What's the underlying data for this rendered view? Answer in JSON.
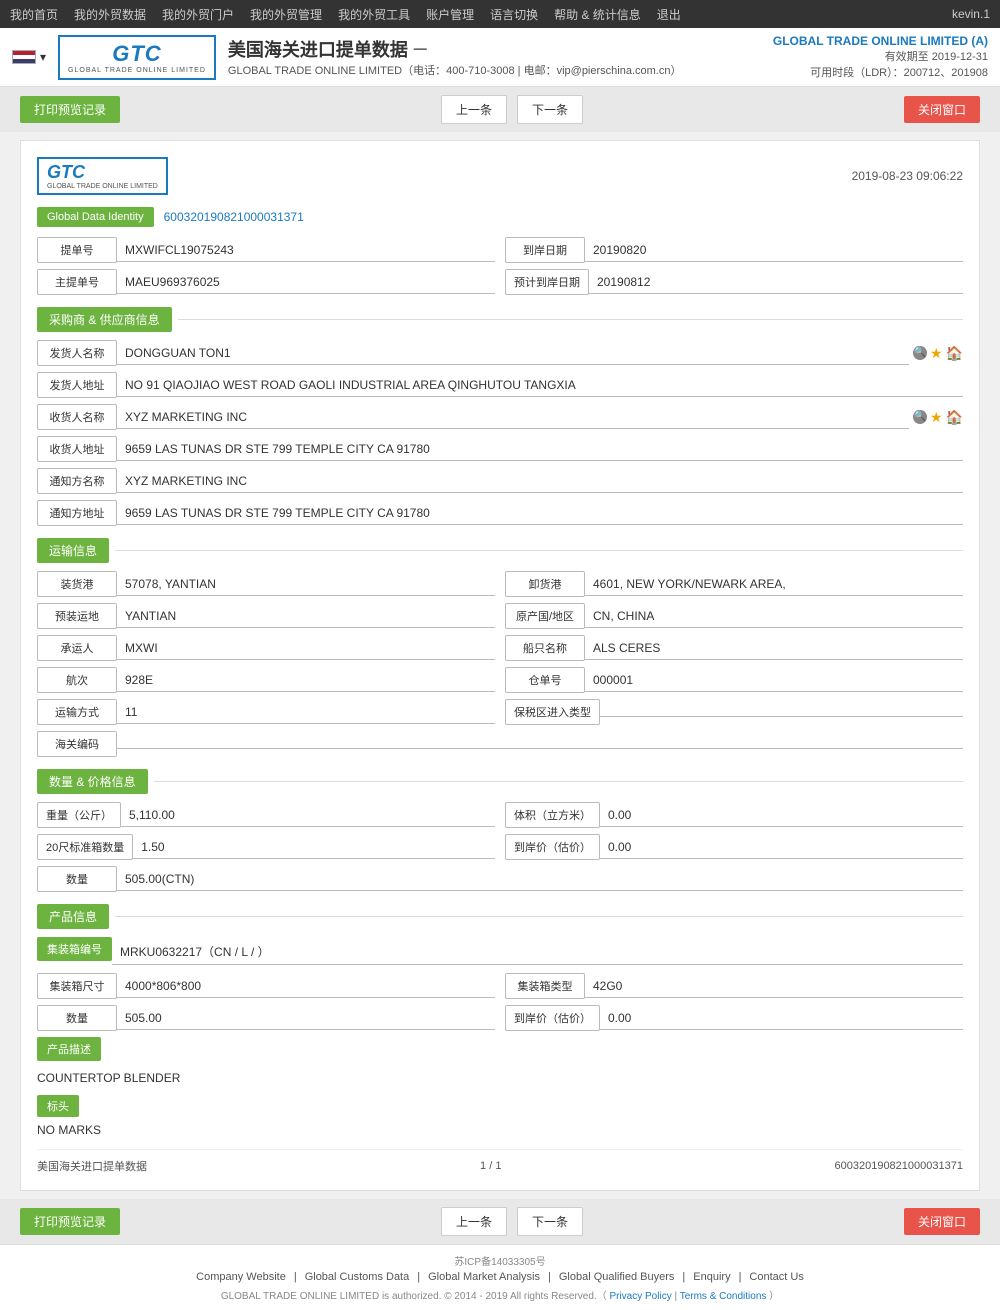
{
  "nav": {
    "items": [
      "我的首页",
      "我的外贸数据",
      "我的外贸门户",
      "我的外贸管理",
      "我的外贸工具",
      "账户管理",
      "语言切换",
      "帮助 & 统计信息",
      "退出"
    ],
    "user": "kevin.1"
  },
  "header": {
    "logo_text": "GTC",
    "logo_sub": "GLOBAL TRADE ONLINE LIMITED",
    "title": "美国海关进口提单数据",
    "dash": "－",
    "contact": "GLOBAL TRADE ONLINE LIMITED（电话：400-710-3008 | 电邮：vip@pierschina.com.cn）",
    "company": "GLOBAL TRADE ONLINE LIMITED (A)",
    "validity": "有效期至 2019-12-31",
    "ldr": "可用时段（LDR）：200712、201908"
  },
  "toolbar": {
    "print_label": "打印预览记录",
    "prev_label": "上一条",
    "next_label": "下一条",
    "close_label": "关闭窗口"
  },
  "card": {
    "date": "2019-08-23 09:06:22",
    "global_data_identity_label": "Global Data Identity",
    "global_data_identity_value": "600320190821000031371",
    "bill_no_label": "提单号",
    "bill_no_value": "MXWIFCL19075243",
    "arrival_date_label": "到岸日期",
    "arrival_date_value": "20190820",
    "master_bill_label": "主提单号",
    "master_bill_value": "MAEU969376025",
    "estimated_arrival_label": "预计到岸日期",
    "estimated_arrival_value": "20190812"
  },
  "supplier": {
    "section_title": "采购商 & 供应商信息",
    "shipper_name_label": "发货人名称",
    "shipper_name_value": "DONGGUAN TON1",
    "shipper_addr_label": "发货人地址",
    "shipper_addr_value": "NO 91 QIAOJIAO WEST ROAD GAOLI INDUSTRIAL AREA QINGHUTOU TANGXIA",
    "consignee_name_label": "收货人名称",
    "consignee_name_value": "XYZ MARKETING INC",
    "consignee_addr_label": "收货人地址",
    "consignee_addr_value": "9659 LAS TUNAS DR STE 799 TEMPLE CITY CA 91780",
    "notify_name_label": "通知方名称",
    "notify_name_value": "XYZ MARKETING INC",
    "notify_addr_label": "通知方地址",
    "notify_addr_value": "9659 LAS TUNAS DR STE 799 TEMPLE CITY CA 91780"
  },
  "transport": {
    "section_title": "运输信息",
    "loading_port_label": "装货港",
    "loading_port_value": "57078, YANTIAN",
    "discharge_port_label": "卸货港",
    "discharge_port_value": "4601, NEW YORK/NEWARK AREA,",
    "trans_mode_from_label": "预装运地",
    "trans_mode_from_value": "YANTIAN",
    "origin_country_label": "原产国/地区",
    "origin_country_value": "CN, CHINA",
    "carrier_label": "承运人",
    "carrier_value": "MXWI",
    "vessel_name_label": "船只名称",
    "vessel_name_value": "ALS CERES",
    "voyage_label": "航次",
    "voyage_value": "928E",
    "container_no_label": "仓单号",
    "container_no_value": "000001",
    "transport_mode_label": "运输方式",
    "transport_mode_value": "11",
    "bonded_zone_label": "保税区进入类型",
    "bonded_zone_value": "",
    "customs_code_label": "海关编码",
    "customs_code_value": ""
  },
  "quantity": {
    "section_title": "数量 & 价格信息",
    "weight_label": "重量（公斤）",
    "weight_value": "5,110.00",
    "volume_label": "体积（立方米）",
    "volume_value": "0.00",
    "std_container_label": "20尺标准箱数量",
    "std_container_value": "1.50",
    "arrival_price_label": "到岸价（估价）",
    "arrival_price_value": "0.00",
    "quantity_label": "数量",
    "quantity_value": "505.00(CTN)"
  },
  "product": {
    "section_title": "产品信息",
    "container_no_label": "集装箱编号",
    "container_no_value": "MRKU0632217（CN / L /  ）",
    "container_size_label": "集装箱尺寸",
    "container_size_value": "4000*806*800",
    "container_type_label": "集装箱类型",
    "container_type_value": "42G0",
    "quantity_label": "数量",
    "quantity_value": "505.00",
    "arrival_price_label": "到岸价（估价）",
    "arrival_price_value": "0.00",
    "description_label": "产品描述",
    "description_value": "COUNTERTOP BLENDER",
    "marks_label": "标头",
    "marks_value": "NO MARKS"
  },
  "card_footer": {
    "left": "美国海关进口提单数据",
    "center": "1 / 1",
    "right": "600320190821000031371"
  },
  "site_footer": {
    "icp": "苏ICP备14033305号",
    "links": [
      "Company Website",
      "Global Customs Data",
      "Global Market Analysis",
      "Global Qualified Buyers",
      "Enquiry",
      "Contact Us"
    ],
    "copyright": "GLOBAL TRADE ONLINE LIMITED is authorized. © 2014 - 2019 All rights Reserved.（",
    "privacy": "Privacy Policy",
    "terms": "Terms & Conditions",
    "end": "）"
  }
}
